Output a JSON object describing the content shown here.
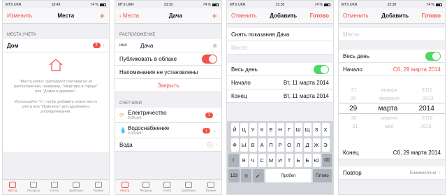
{
  "status": {
    "carrier": "MTS UKR",
    "times": [
      "18:49",
      "23:30",
      "23:30",
      "23:30"
    ],
    "battery": "74 %"
  },
  "s1": {
    "edit": "Изменить",
    "title": "Места",
    "add": "+",
    "section": "МЕСТА УЧЕТА",
    "place": "Дом",
    "place_count": "7",
    "help1": "\"Места учета\" группируют счетчики по их расположению, например, \"Квартира в городе\" или \"Домик в деревне\".",
    "help2": "Используйте \"+\", чтобы добавить новое место учета или \"Изменить\" для удаления и упорядочивания."
  },
  "tabs": [
    "Места",
    "Ресурсы",
    "Счета",
    "Шаблоны",
    "Тюнинг"
  ],
  "s2": {
    "back": "Места",
    "title": "Дача",
    "add": "+",
    "section": "РАСПОЛОЖЕНИЕ",
    "name_label": "имя",
    "name_value": "Дача",
    "publish": "Публиковать в облаке",
    "reminders": "Напоминания не установлены",
    "close": "Закрыть",
    "meters_section": "СЧЕТЧИКИ",
    "meters": [
      {
        "name": "Електричество",
        "sub": "0,00 руб.",
        "count": "1"
      },
      {
        "name": "Водоснабжение",
        "sub": "0,00 руб.",
        "count": "1"
      },
      {
        "name": "Вода",
        "sub": "",
        "count": ""
      }
    ]
  },
  "s3": {
    "cancel": "Отменить",
    "title": "Добавить",
    "done": "Готово",
    "field_value": "Снять показания Дача",
    "place_ph": "Место",
    "allday": "Весь день",
    "start_label": "Начало",
    "start_value": "Вт, 11 марта 2014",
    "end_label": "Конец",
    "end_value": "Вт, 11 марта 2014",
    "keys": [
      [
        "Й",
        "Ц",
        "У",
        "К",
        "Е",
        "Н",
        "Г",
        "Ш",
        "Щ",
        "З",
        "Х"
      ],
      [
        "Ф",
        "Ы",
        "В",
        "А",
        "П",
        "Р",
        "О",
        "Л",
        "Д",
        "Ж",
        "Э"
      ],
      [
        "Я",
        "Ч",
        "С",
        "М",
        "И",
        "Т",
        "Ь",
        "Б",
        "Ю"
      ]
    ],
    "key_num": "123",
    "key_space": "Пробел",
    "key_done": "Готово"
  },
  "s4": {
    "cancel": "Отменить",
    "title": "Добавить",
    "done": "Готово",
    "place_ph": "Место",
    "allday": "Весь день",
    "start_label": "Начало",
    "start_value": "Сб, 29 марта 2014",
    "wheel": [
      [
        "27",
        "января",
        "2012"
      ],
      [
        "28",
        "февраля",
        "2013"
      ],
      [
        "29",
        "марта",
        "2014"
      ],
      [
        "30",
        "апреля",
        "2015"
      ],
      [
        "31",
        "мая",
        "2016"
      ]
    ],
    "end_label": "Конец",
    "end_value": "Сб, 29 марта 2014",
    "repeat_label": "Повтор",
    "repeat_value": "Ежемесячно"
  },
  "colors": {
    "accent": "#f0524a",
    "green": "#4cd964"
  }
}
